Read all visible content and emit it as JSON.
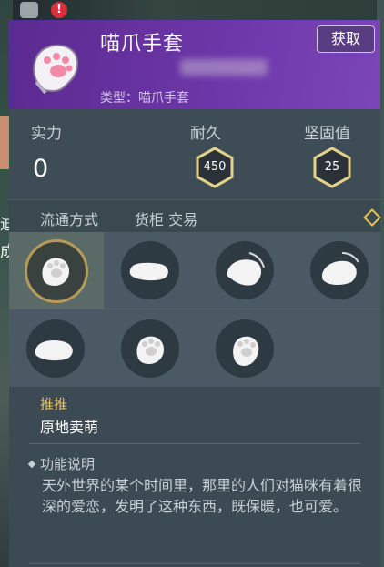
{
  "background": {
    "alert_glyph": "!",
    "left_text_1": "迪",
    "left_text_2": "成"
  },
  "item": {
    "title": "喵爪手套",
    "type_line": "类型：喵爪手套",
    "get_label": "获取",
    "icon": "cat-paw-glove-icon"
  },
  "stats": {
    "power_label": "实力",
    "power_value": "0",
    "durability_label": "耐久",
    "durability_value": "450",
    "firmness_label": "坚固值",
    "firmness_value": "25",
    "hex_color": "#e4d28a"
  },
  "circulation": {
    "label": "流通方式",
    "value": "货柜 交易"
  },
  "styles": [
    {
      "icon": "paw-glove-icon",
      "selected": true
    },
    {
      "icon": "mitten-flat-icon",
      "selected": false
    },
    {
      "icon": "mitten-wave-icon",
      "selected": false
    },
    {
      "icon": "mitten-wave-icon",
      "selected": false
    },
    {
      "icon": "mitten-flat-icon",
      "selected": false
    },
    {
      "icon": "paw-glove-icon",
      "selected": false
    },
    {
      "icon": "paw-glove-icon",
      "selected": false
    }
  ],
  "recommend": {
    "author": "推推",
    "work": "原地卖萌"
  },
  "function": {
    "title": "功能说明",
    "body": "天外世界的某个时间里，那里的人们对猫咪有着很深的爱恋，发明了这种东西，既保暖，也可爱。"
  },
  "colors": {
    "header": "#6c36a8",
    "accent_gold": "#e9c46a",
    "panel": "#3e4c55"
  }
}
